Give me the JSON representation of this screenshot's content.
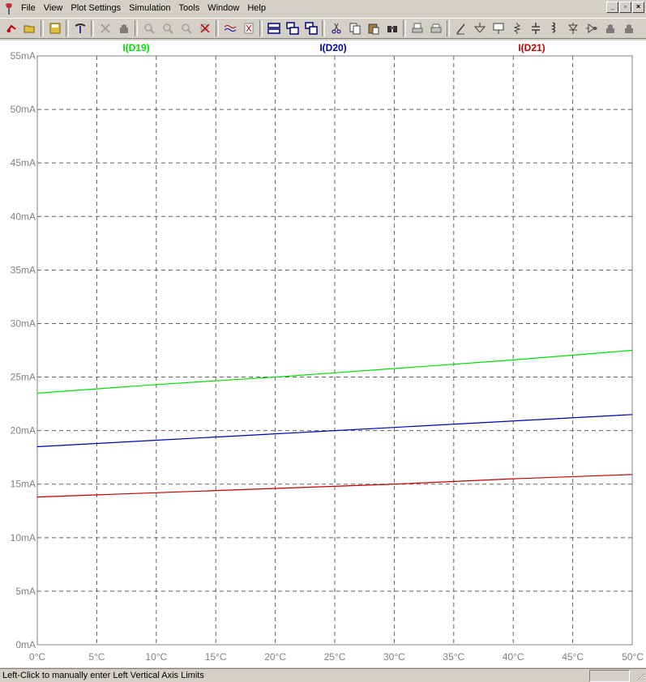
{
  "menu": {
    "items": [
      "File",
      "View",
      "Plot Settings",
      "Simulation",
      "Tools",
      "Window",
      "Help"
    ]
  },
  "window_controls": [
    "minimize-icon",
    "restore-icon",
    "close-icon"
  ],
  "toolbar": {
    "buttons": [
      "run-icon",
      "open-icon",
      "save-icon",
      "control-panel-icon",
      "halt-icon",
      "pan-icon",
      "zoom-in-icon",
      "zoom-area-icon",
      "zoom-out-icon",
      "zoom-fit-icon",
      "autorange-icon",
      "delete-trace-icon",
      "tile-horizontal-icon",
      "cascade-icon",
      "tile-vertical-icon",
      "cut-icon",
      "copy-icon",
      "paste-icon",
      "find-icon",
      "print-preview-icon",
      "print-icon",
      "wire-icon",
      "ground-icon",
      "label-icon",
      "resistor-icon",
      "capacitor-icon",
      "inductor-icon",
      "diode-icon",
      "component-icon",
      "move-icon"
    ]
  },
  "chart_data": {
    "type": "line",
    "title": "",
    "xlabel": "",
    "ylabel": "",
    "x_unit": "°C",
    "y_unit": "mA",
    "xlim": [
      0,
      50
    ],
    "ylim": [
      0,
      55
    ],
    "x_ticks": [
      "0°C",
      "5°C",
      "10°C",
      "15°C",
      "20°C",
      "25°C",
      "30°C",
      "35°C",
      "40°C",
      "45°C",
      "50°C"
    ],
    "y_ticks": [
      "0mA",
      "5mA",
      "10mA",
      "15mA",
      "20mA",
      "25mA",
      "30mA",
      "35mA",
      "40mA",
      "45mA",
      "50mA",
      "55mA"
    ],
    "grid": true,
    "legend": "top",
    "x": [
      0,
      10,
      20,
      30,
      40,
      50
    ],
    "series": [
      {
        "name": "I(D19)",
        "color": "#00e000",
        "values": [
          23.5,
          24.3,
          25.0,
          25.8,
          26.6,
          27.5
        ]
      },
      {
        "name": "I(D20)",
        "color": "#0000b0",
        "values": [
          18.5,
          19.1,
          19.7,
          20.3,
          20.9,
          21.5
        ]
      },
      {
        "name": "I(D21)",
        "color": "#c00000",
        "values": [
          13.8,
          14.2,
          14.6,
          15.0,
          15.5,
          15.9
        ]
      }
    ]
  },
  "status": {
    "text": "Left-Click to manually enter Left Vertical Axis Limits"
  }
}
